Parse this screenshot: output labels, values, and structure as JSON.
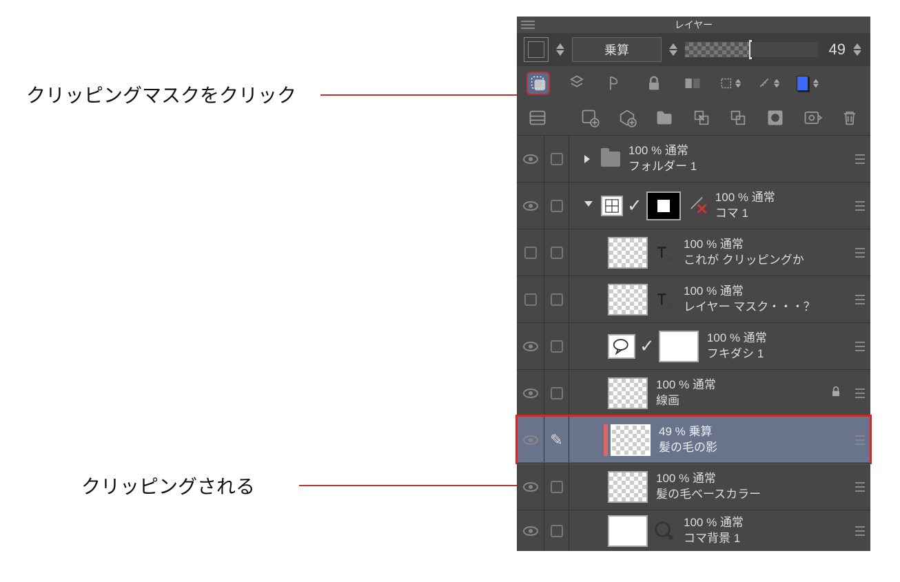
{
  "panel_title": "レイヤー",
  "blend_mode": "乗算",
  "opacity": "49",
  "annotations": {
    "clip_click": "クリッピングマスクをクリック",
    "clipped": "クリッピングされる"
  },
  "layers": [
    {
      "opacity_mode": "100 %  通常",
      "name": "フォルダー 1"
    },
    {
      "opacity_mode": "100 %  通常",
      "name": "コマ 1"
    },
    {
      "opacity_mode": "100 %  通常",
      "name": "これが クリッピングか"
    },
    {
      "opacity_mode": "100 %  通常",
      "name": "レイヤー マスク・・・？"
    },
    {
      "opacity_mode": "100 %  通常",
      "name": "フキダシ 1"
    },
    {
      "opacity_mode": "100 %  通常",
      "name": "線画"
    },
    {
      "opacity_mode": "49 %  乗算",
      "name": "髪の毛の影"
    },
    {
      "opacity_mode": "100 %  通常",
      "name": "髪の毛ベースカラー"
    },
    {
      "opacity_mode": "100 %  通常",
      "name": "コマ背景 1"
    }
  ]
}
